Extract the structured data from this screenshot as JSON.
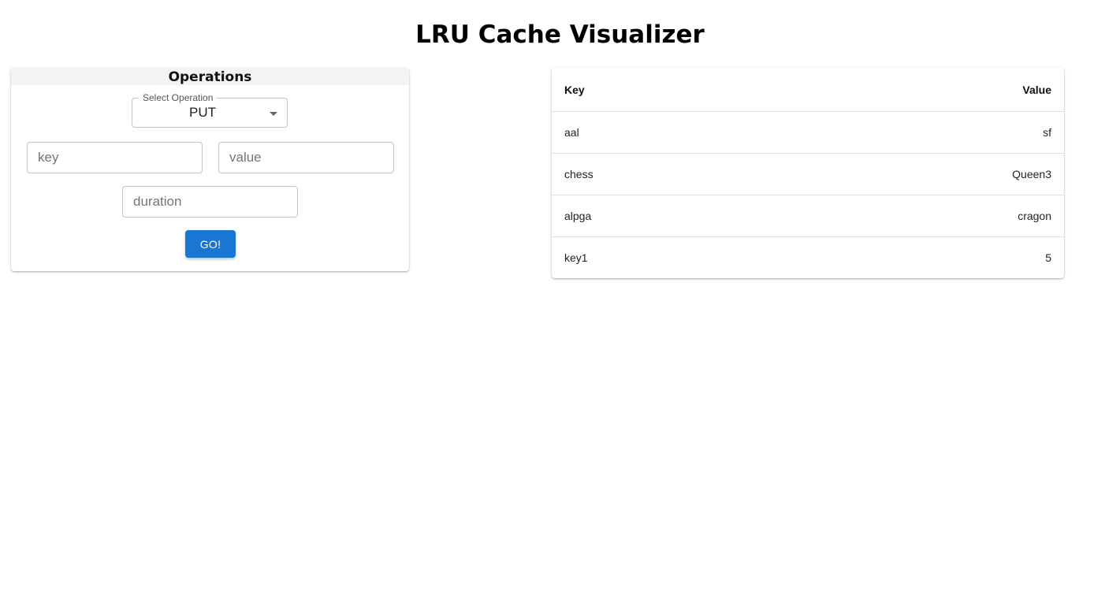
{
  "page": {
    "title": "LRU Cache Visualizer"
  },
  "operations": {
    "title": "Operations",
    "select_label": "Select Operation",
    "selected_operation": "PUT",
    "key_placeholder": "key",
    "value_placeholder": "value",
    "duration_placeholder": "duration",
    "go_label": "GO!"
  },
  "cache_table": {
    "headers": {
      "key": "Key",
      "value": "Value"
    },
    "rows": [
      {
        "key": "aal",
        "value": "sf"
      },
      {
        "key": "chess",
        "value": "Queen3"
      },
      {
        "key": "alpga",
        "value": "cragon"
      },
      {
        "key": "key1",
        "value": "5"
      }
    ]
  },
  "colors": {
    "button": "#1976d2",
    "header_bg": "#f2f3f5"
  }
}
